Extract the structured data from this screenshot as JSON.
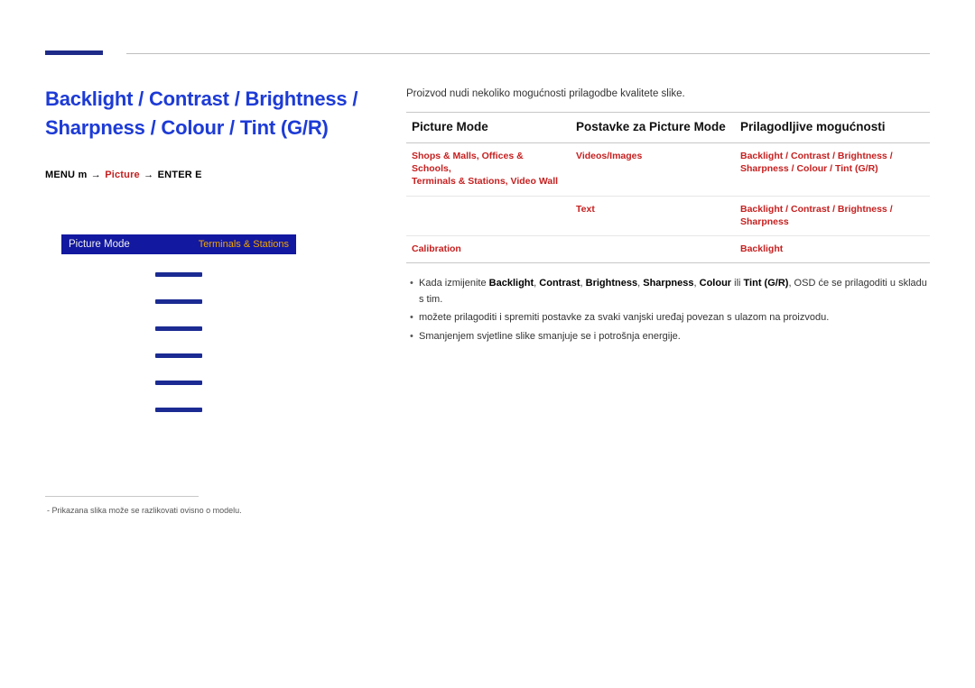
{
  "title_line1": "Backlight / Contrast / Brightness /",
  "title_line2": "Sharpness / Colour / Tint (G/R)",
  "breadcrumb": {
    "menu": "MENU",
    "menu_icon": "m",
    "arrow": "→",
    "picture": "Picture",
    "enter": "ENTER",
    "enter_icon": "E"
  },
  "osd": {
    "mode_label": "Picture Mode",
    "mode_value": "Terminals & Stations"
  },
  "footnote": "Prikazana slika može se razlikovati ovisno o modelu.",
  "intro": "Proizvod nudi nekoliko mogućnosti prilagodbe kvalitete slike.",
  "headers": {
    "c1": "Picture Mode",
    "c2": "Postavke za Picture Mode",
    "c3": "Prilagodljive mogućnosti"
  },
  "rows": [
    {
      "c1_a": "Shops & Malls",
      "c1_sep1": ", ",
      "c1_b": "Offices & Schools",
      "c1_sep2": ",",
      "c1_c": "Terminals & Stations",
      "c1_sep3": ", ",
      "c1_d": "Video Wall",
      "c2": "Videos/Images",
      "c3": "Backlight / Contrast / Brightness / Sharpness / Colour / Tint (G/R)"
    },
    {
      "c1": "",
      "c2": "Text",
      "c3": "Backlight / Contrast / Brightness / Sharpness"
    },
    {
      "c1": "Calibration",
      "c2": "",
      "c3": "Backlight"
    }
  ],
  "bullets": {
    "b1_pre": "Kada izmijenite ",
    "b1_terms": {
      "t1": "Backlight",
      "s1": ", ",
      "t2": "Contrast",
      "s2": ", ",
      "t3": "Brightness",
      "s3": ", ",
      "t4": "Sharpness",
      "s4": ", ",
      "t5": "Colour",
      "s5": " ili ",
      "t6": "Tint (G/R)"
    },
    "b1_post": ", OSD će se prilagoditi u skladu s tim.",
    "b2": "možete prilagoditi i spremiti postavke za svaki vanjski uređaj povezan s ulazom na proizvodu.",
    "b3": "Smanjenjem svjetline slike smanjuje se i potrošnja energije."
  }
}
